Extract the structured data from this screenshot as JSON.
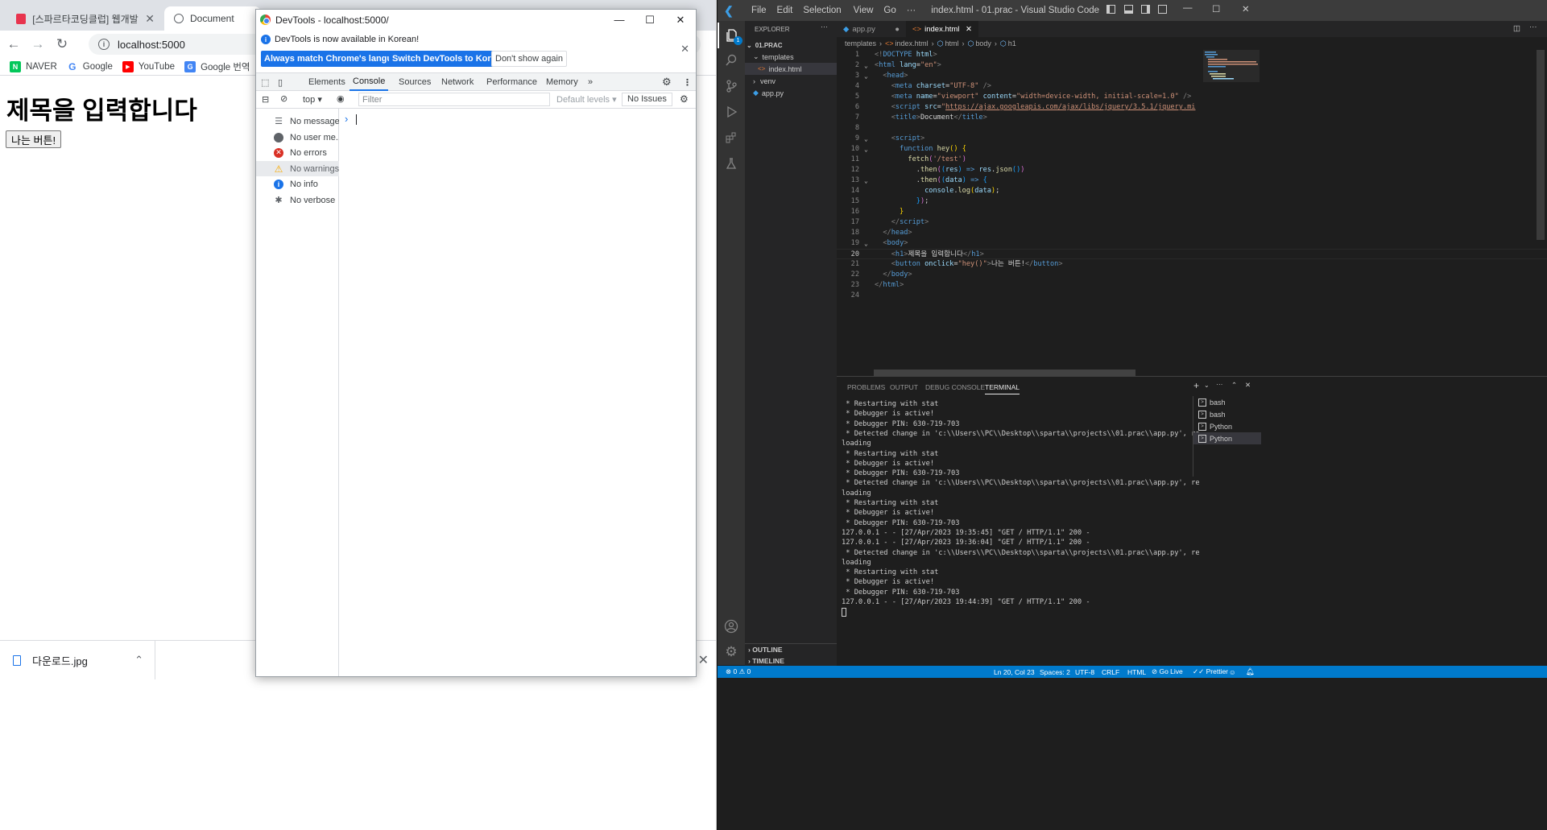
{
  "chrome": {
    "tabs": [
      {
        "title": "[스파르타코딩클럽] 웹개발 종합"
      },
      {
        "title": "Document"
      }
    ],
    "tab_close": "✕",
    "url": "localhost:5000",
    "bookmarks": [
      {
        "label": "NAVER",
        "icon": "naver-icon",
        "color": "#03c75a",
        "glyph": "N"
      },
      {
        "label": "Google",
        "icon": "google-icon",
        "color": "#4285f4",
        "glyph": "G"
      },
      {
        "label": "YouTube",
        "icon": "youtube-icon",
        "color": "#ff0000",
        "glyph": "▶"
      },
      {
        "label": "Google 번역",
        "icon": "google-translate-icon",
        "color": "#4285f4",
        "glyph": "G"
      }
    ],
    "page": {
      "heading": "제목을 입력합니다",
      "button_label": "나는 버튼!"
    },
    "download": {
      "filename": "다운로드.jpg"
    }
  },
  "devtools": {
    "window_title": "DevTools - localhost:5000/",
    "infobar": {
      "message": "DevTools is now available in Korean!",
      "buttons": [
        "Always match Chrome's language",
        "Switch DevTools to Korean",
        "Don't show again"
      ]
    },
    "tabs": [
      "Elements",
      "Console",
      "Sources",
      "Network",
      "Performance",
      "Memory"
    ],
    "active_tab": "Console",
    "context": "top",
    "filter_placeholder": "Filter",
    "levels": "Default levels",
    "issues": "No Issues",
    "sidebar": [
      {
        "label": "No messages",
        "icon": "list-icon"
      },
      {
        "label": "No user me...",
        "icon": "user-icon"
      },
      {
        "label": "No errors",
        "icon": "error-icon"
      },
      {
        "label": "No warnings",
        "icon": "warning-icon"
      },
      {
        "label": "No info",
        "icon": "info-icon"
      },
      {
        "label": "No verbose",
        "icon": "bug-icon"
      }
    ],
    "prompt": "›"
  },
  "vscode": {
    "title": "index.html - 01.prac - Visual Studio Code",
    "menu": [
      "File",
      "Edit",
      "Selection",
      "View",
      "Go",
      "···"
    ],
    "explorer": {
      "header": "EXPLORER",
      "root": "01.PRAC",
      "items": [
        {
          "label": "templates",
          "type": "folder-open"
        },
        {
          "label": "index.html",
          "type": "html-file"
        },
        {
          "label": "venv",
          "type": "folder"
        },
        {
          "label": "app.py",
          "type": "python-file"
        }
      ]
    },
    "editor_tabs": [
      {
        "label": "app.py"
      },
      {
        "label": "index.html"
      }
    ],
    "breadcrumb": [
      "templates",
      "index.html",
      "html",
      "body",
      "h1"
    ],
    "current_line": 20,
    "panel_tabs": [
      "PROBLEMS",
      "OUTPUT",
      "DEBUG CONSOLE",
      "TERMINAL"
    ],
    "active_panel_tab": "TERMINAL",
    "terminal_lines": [
      " * Restarting with stat",
      " * Debugger is active!",
      " * Debugger PIN: 630-719-703",
      " * Detected change in 'c:\\\\Users\\\\PC\\\\Desktop\\\\sparta\\\\projects\\\\01.prac\\\\app.py', re",
      "loading",
      " * Restarting with stat",
      " * Debugger is active!",
      " * Debugger PIN: 630-719-703",
      " * Detected change in 'c:\\\\Users\\\\PC\\\\Desktop\\\\sparta\\\\projects\\\\01.prac\\\\app.py', re",
      "loading",
      " * Restarting with stat",
      " * Debugger is active!",
      " * Debugger PIN: 630-719-703",
      "127.0.0.1 - - [27/Apr/2023 19:35:45] \"GET / HTTP/1.1\" 200 -",
      "127.0.0.1 - - [27/Apr/2023 19:36:04] \"GET / HTTP/1.1\" 200 -",
      " * Detected change in 'c:\\\\Users\\\\PC\\\\Desktop\\\\sparta\\\\projects\\\\01.prac\\\\app.py', re",
      "loading",
      " * Restarting with stat",
      " * Debugger is active!",
      " * Debugger PIN: 630-719-703",
      "127.0.0.1 - - [27/Apr/2023 19:44:39] \"GET / HTTP/1.1\" 200 -"
    ],
    "terminals": [
      "bash",
      "bash",
      "Python",
      "Python"
    ],
    "outline": "OUTLINE",
    "timeline": "TIMELINE",
    "status": {
      "problems": "⊗ 0 ⚠ 0",
      "position": "Ln 20, Col 23",
      "spaces": "Spaces: 2",
      "encoding": "UTF-8",
      "eol": "CRLF",
      "language": "HTML",
      "golive": "⊘ Go Live",
      "prettier": "✓✓ Prettier"
    },
    "colors": {
      "status_bar": "#007acc",
      "editor_bg": "#1e1e1e",
      "sidebar_bg": "#252526"
    }
  }
}
